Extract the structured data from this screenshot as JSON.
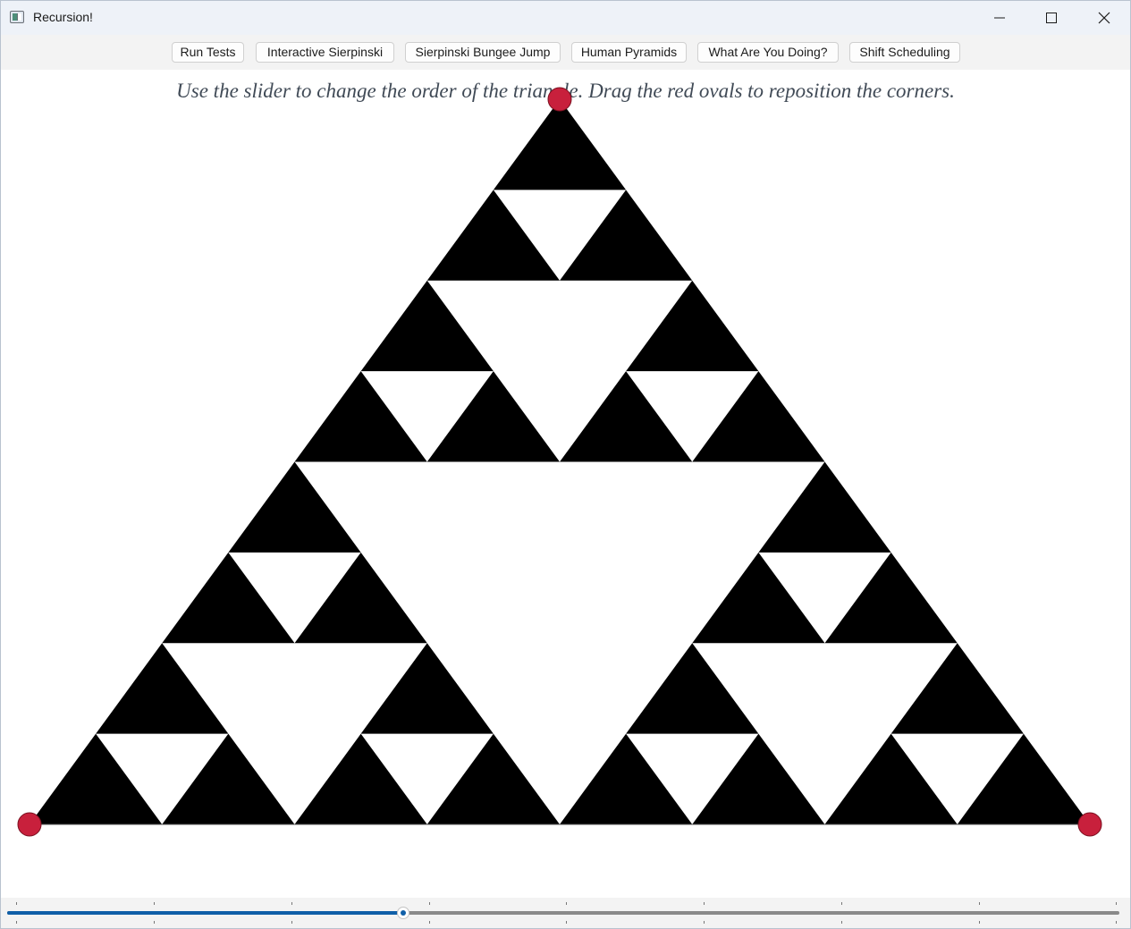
{
  "window": {
    "title": "Recursion!",
    "icon": "app-window-icon",
    "controls": [
      "minimize-icon",
      "maximize-icon",
      "close-icon"
    ]
  },
  "toolbar": {
    "buttons": [
      {
        "label": "Run Tests"
      },
      {
        "label": "Interactive Sierpinski"
      },
      {
        "label": "Sierpinski Bungee Jump"
      },
      {
        "label": "Human Pyramids"
      },
      {
        "label": "What Are You Doing?"
      },
      {
        "label": "Shift Scheduling"
      }
    ]
  },
  "instructions": "Use the slider to change the order of the triangle. Drag the red ovals to reposition the corners.",
  "sierpinski": {
    "order": 4,
    "fill_color": "#000000",
    "background_color": "#ffffff",
    "handle_color": "#c8203c"
  },
  "slider": {
    "min": 1,
    "max": 9,
    "value": 4,
    "track_color": "#8a8a8a",
    "fill_color": "#0f5fa8"
  },
  "colors": {
    "instruction_text": "#404a56",
    "titlebar": "#eef2f8",
    "toolbar": "#f3f3f3"
  }
}
